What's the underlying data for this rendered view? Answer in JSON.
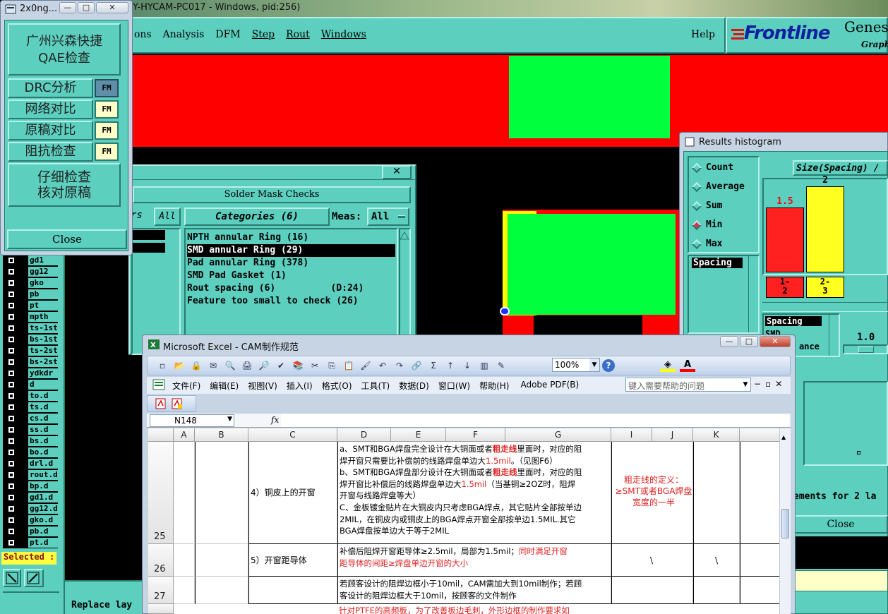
{
  "top_window_title": "Y-HYCAM-PC017 - Windows, pid:256)",
  "menu": {
    "items": [
      "ons",
      "Analysis",
      "DFM",
      "Step",
      "Rout",
      "Windows"
    ],
    "help": "Help"
  },
  "brand": {
    "name": "Frontline",
    "product": "Genes",
    "sub": "Graph"
  },
  "qae_window": {
    "title": "2x0ng...",
    "title_buttons": [
      "—",
      "□",
      "✕"
    ],
    "btn_qae": "广州兴森快捷 QAE检查",
    "rows": [
      {
        "label": "DRC分析",
        "tag": "FM"
      },
      {
        "label": "网络对比",
        "tag": "FM"
      },
      {
        "label": "原稿对比",
        "tag": "FM"
      },
      {
        "label": "阻抗检查",
        "tag": "FM"
      }
    ],
    "btn_detail": "仔细检查 核对原稿",
    "close": "Close"
  },
  "layers": {
    "items": [
      "gd1",
      "gg12",
      "gko",
      "pb",
      "pt",
      "mpth",
      "ts-1st",
      "bs-1st",
      "ts-2st",
      "bs-2st",
      "ydkdr",
      "d",
      "to.d",
      "ts.d",
      "cs.d",
      "ss.d",
      "bs.d",
      "bo.d",
      "drl.d",
      "rout.d",
      "bp.d",
      "gd1.d",
      "gg12.d",
      "gko.d",
      "pb.d",
      "pt.d"
    ],
    "selected_label": "Selected :",
    "replace_label": "Replace lay"
  },
  "solder_mask": {
    "close": "✕",
    "title": "Solder Mask Checks",
    "filter_label": "rs",
    "filter_value": "All",
    "categories_label": "Categories (6)",
    "meas_label": "Meas:",
    "meas_value": "All",
    "items": [
      "NPTH annular Ring (16)",
      "SMD annular Ring (29)",
      "Pad annular Ring (378)",
      "SMD Pad Gasket (1)",
      "Rout spacing (6)          (D:24)",
      "Feature too small to check (26)"
    ],
    "selected_index": 1
  },
  "histogram": {
    "title": "Results histogram",
    "options": [
      "Count",
      "Average",
      "Sum",
      "Min",
      "Max"
    ],
    "selected_option": "Min",
    "list_item": "Spacing",
    "header": "Size(Spacing) /",
    "bars": [
      {
        "label": "1-\n2",
        "value": 1.5,
        "value_text": "1.5",
        "color": "#ff2020"
      },
      {
        "label": "2-\n3",
        "value": 2,
        "value_text": "2",
        "color": "#ffff20"
      }
    ],
    "y_max": 2,
    "lower_list": [
      "Spacing",
      "SMD",
      "ance"
    ],
    "slider_value": "1.0",
    "bottom_text": "ements for 2 la",
    "close": "Close"
  },
  "excel": {
    "title": "Microsoft Excel - CAM制作规范",
    "zoom": "100%",
    "menu": [
      "文件(F)",
      "编辑(E)",
      "视图(V)",
      "插入(I)",
      "格式(O)",
      "工具(T)",
      "数据(D)",
      "窗口(W)",
      "帮助(H)",
      "Adobe PDF(B)"
    ],
    "help_placeholder": "键入需要帮助的问题",
    "name_box": "N148",
    "fx": "fx",
    "columns": [
      "A",
      "B",
      "C",
      "D",
      "E",
      "F",
      "G",
      "I",
      "J",
      "K"
    ],
    "rows": [
      {
        "num": "25",
        "c": "4）铜皮上的开窗",
        "text_lines": [
          [
            {
              "t": "a、SMT和BGA焊盘完全设计在大铜面或者"
            },
            {
              "t": "粗走线",
              "r": 1
            },
            {
              "t": "里面时，对应的阻"
            }
          ],
          [
            {
              "t": "焊开窗只需要比补偿前的线路焊盘单边大"
            },
            {
              "t": "1.5mil",
              "r": 1
            },
            {
              "t": "。（见图F6）"
            }
          ],
          [
            {
              "t": "b、SMT和BGA焊盘部分设计在大铜面或者"
            },
            {
              "t": "粗走线",
              "r": 1
            },
            {
              "t": "里面时，对应的阻"
            }
          ],
          [
            {
              "t": "焊开窗比补偿后的线路焊盘单边大"
            },
            {
              "t": "1.5mil",
              "r": 1
            },
            {
              "t": "（当基铜≥2OZ时，阻焊"
            }
          ],
          [
            {
              "t": "开窗与线路焊盘等大）"
            }
          ],
          [
            {
              "t": "C、金板镀金贴片在大铜皮内只考虑BGA焊点，其它贴片全部按单边"
            }
          ],
          [
            {
              "t": "2MIL，在铜皮内或铜皮上的BGA焊点开窗全部按单边1.5MIL.其它"
            }
          ],
          [
            {
              "t": "BGA焊盘按单边大于等于2MIL"
            }
          ]
        ],
        "note": "粗走线的定义：≥SMT或者BGA焊盘宽度的一半"
      },
      {
        "num": "26",
        "c": "5）开窗距导体",
        "text_lines": [
          [
            {
              "t": "补偿后阻焊开窗距导体≥2.5mil，局部为1.5mil；"
            },
            {
              "t": "同时满足开窗",
              "r": 1
            }
          ],
          [
            {
              "t": "距导体的间距≥焊盘单边开窗的大小",
              "r": 1
            }
          ]
        ],
        "j": "\\",
        "k": "\\"
      },
      {
        "num": "27",
        "c": "",
        "text_lines": [
          [
            {
              "t": "若顾客设计的阻焊边框小于10mil，CAM需加大到10mil制作；若顾"
            }
          ],
          [
            {
              "t": "客设计的阻焊边框大于10mil，按顾客的文件制作"
            }
          ]
        ]
      }
    ],
    "partial_row": "针对PTFE的高频板，为了改善板边毛刺，外形边框的制作要求如"
  },
  "colors": {
    "teal": "#5ccfbf",
    "red": "#ff0000",
    "green": "#00ff3c",
    "yellow": "#ffff00"
  }
}
